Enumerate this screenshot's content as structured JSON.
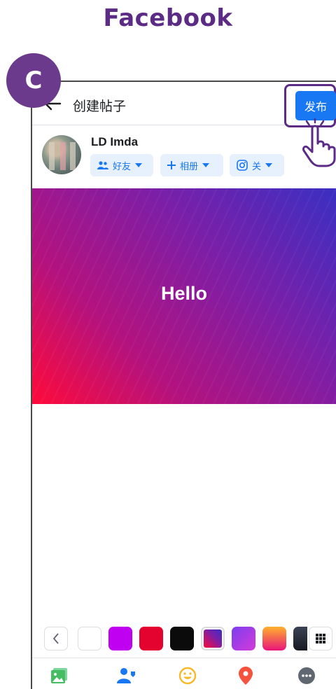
{
  "brand": {
    "title": "Facebook"
  },
  "step": {
    "label": "C"
  },
  "header": {
    "title": "创建帖子",
    "publish_label": "发布"
  },
  "user": {
    "name": "LD Imda"
  },
  "chips": {
    "audience": "好友",
    "album": "相册",
    "instagram": "关"
  },
  "post": {
    "text": "Hello"
  },
  "icons": {
    "back": "back-arrow-icon",
    "hand": "pointing-hand-icon",
    "friends": "friends-icon",
    "plus": "plus-icon",
    "instagram": "instagram-icon",
    "caret": "caret-down-icon",
    "chevron_left": "chevron-left-icon",
    "grid": "grid-icon",
    "photo": "photo-icon",
    "tag_people": "tag-people-icon",
    "feeling": "smiley-icon",
    "location": "location-pin-icon",
    "more": "more-icon"
  },
  "colors": {
    "brand_purple": "#5b2b86",
    "badge_purple": "#6b3a8c",
    "facebook_blue": "#1877f2",
    "chip_bg": "#e7f0fd"
  },
  "backgrounds": [
    {
      "name": "white",
      "color": "#ffffff"
    },
    {
      "name": "purple",
      "color": "#c000f0"
    },
    {
      "name": "red",
      "color": "#e4032e"
    },
    {
      "name": "black",
      "color": "#0b0b0b"
    },
    {
      "name": "purple-red-gradient",
      "color": "#7a1fa8"
    },
    {
      "name": "violet-pink-gradient",
      "color": "#a83de4"
    },
    {
      "name": "orange-pink-gradient",
      "color": "#f46050"
    },
    {
      "name": "dark-gradient",
      "color": "#2a2f3c"
    }
  ]
}
